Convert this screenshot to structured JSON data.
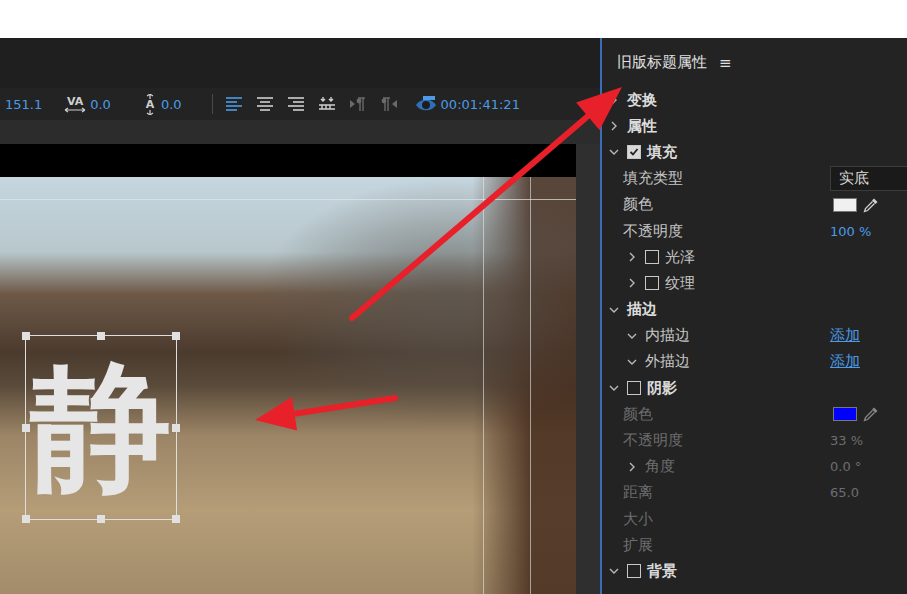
{
  "toolbar": {
    "size_value": "151.1",
    "kerning": {
      "icon_text": "VA",
      "value": "0.0"
    },
    "leading": {
      "icon_text": "A",
      "value": "0.0"
    },
    "align_buttons": [
      {
        "kind": "left",
        "selected": true,
        "disabled": false
      },
      {
        "kind": "center",
        "selected": false,
        "disabled": false
      },
      {
        "kind": "right",
        "selected": false,
        "disabled": false
      },
      {
        "kind": "tabs",
        "selected": false,
        "disabled": false
      },
      {
        "kind": "para-left",
        "selected": false,
        "disabled": true
      },
      {
        "kind": "para-right",
        "selected": false,
        "disabled": true
      }
    ],
    "timecode": "00:01:41:21"
  },
  "canvas": {
    "title_text": "静",
    "title_selected": true
  },
  "panel": {
    "title": "旧版标题属性",
    "menu_icon": "≡",
    "rows": [
      {
        "kind": "section",
        "label": "变换",
        "expanded": false,
        "has_checkbox": false,
        "checked": false,
        "disabled": false
      },
      {
        "kind": "section",
        "label": "属性",
        "expanded": false,
        "has_checkbox": false,
        "checked": false,
        "disabled": false
      },
      {
        "kind": "section",
        "label": "填充",
        "expanded": true,
        "has_checkbox": true,
        "checked": true,
        "disabled": false
      },
      {
        "kind": "select",
        "label": "填充类型",
        "value": "实底",
        "disabled": false
      },
      {
        "kind": "color",
        "label": "颜色",
        "color": "#f0f0f0",
        "disabled": false
      },
      {
        "kind": "value",
        "label": "不透明度",
        "value": "100 %",
        "disabled": false
      },
      {
        "kind": "subsection",
        "label": "光泽",
        "expanded": false,
        "checked": false,
        "disabled": false
      },
      {
        "kind": "subsection",
        "label": "纹理",
        "expanded": false,
        "checked": false,
        "disabled": false
      },
      {
        "kind": "section",
        "label": "描边",
        "expanded": true,
        "has_checkbox": false,
        "checked": false,
        "disabled": false
      },
      {
        "kind": "link",
        "label": "内描边",
        "expanded": true,
        "value": "添加",
        "disabled": false
      },
      {
        "kind": "link",
        "label": "外描边",
        "expanded": true,
        "value": "添加",
        "disabled": false
      },
      {
        "kind": "section",
        "label": "阴影",
        "expanded": true,
        "has_checkbox": true,
        "checked": false,
        "disabled": false
      },
      {
        "kind": "color",
        "label": "颜色",
        "color": "#0000ff",
        "disabled": true
      },
      {
        "kind": "value",
        "label": "不透明度",
        "value": "33 %",
        "disabled": true
      },
      {
        "kind": "group-value",
        "label": "角度",
        "expanded": false,
        "value": "0.0 °",
        "disabled": true
      },
      {
        "kind": "value",
        "label": "距离",
        "value": "65.0",
        "disabled": true
      },
      {
        "kind": "value",
        "label": "大小",
        "value": "",
        "disabled": true
      },
      {
        "kind": "value",
        "label": "扩展",
        "value": "",
        "disabled": true
      },
      {
        "kind": "section",
        "label": "背景",
        "expanded": true,
        "has_checkbox": true,
        "checked": false,
        "disabled": false
      }
    ]
  }
}
